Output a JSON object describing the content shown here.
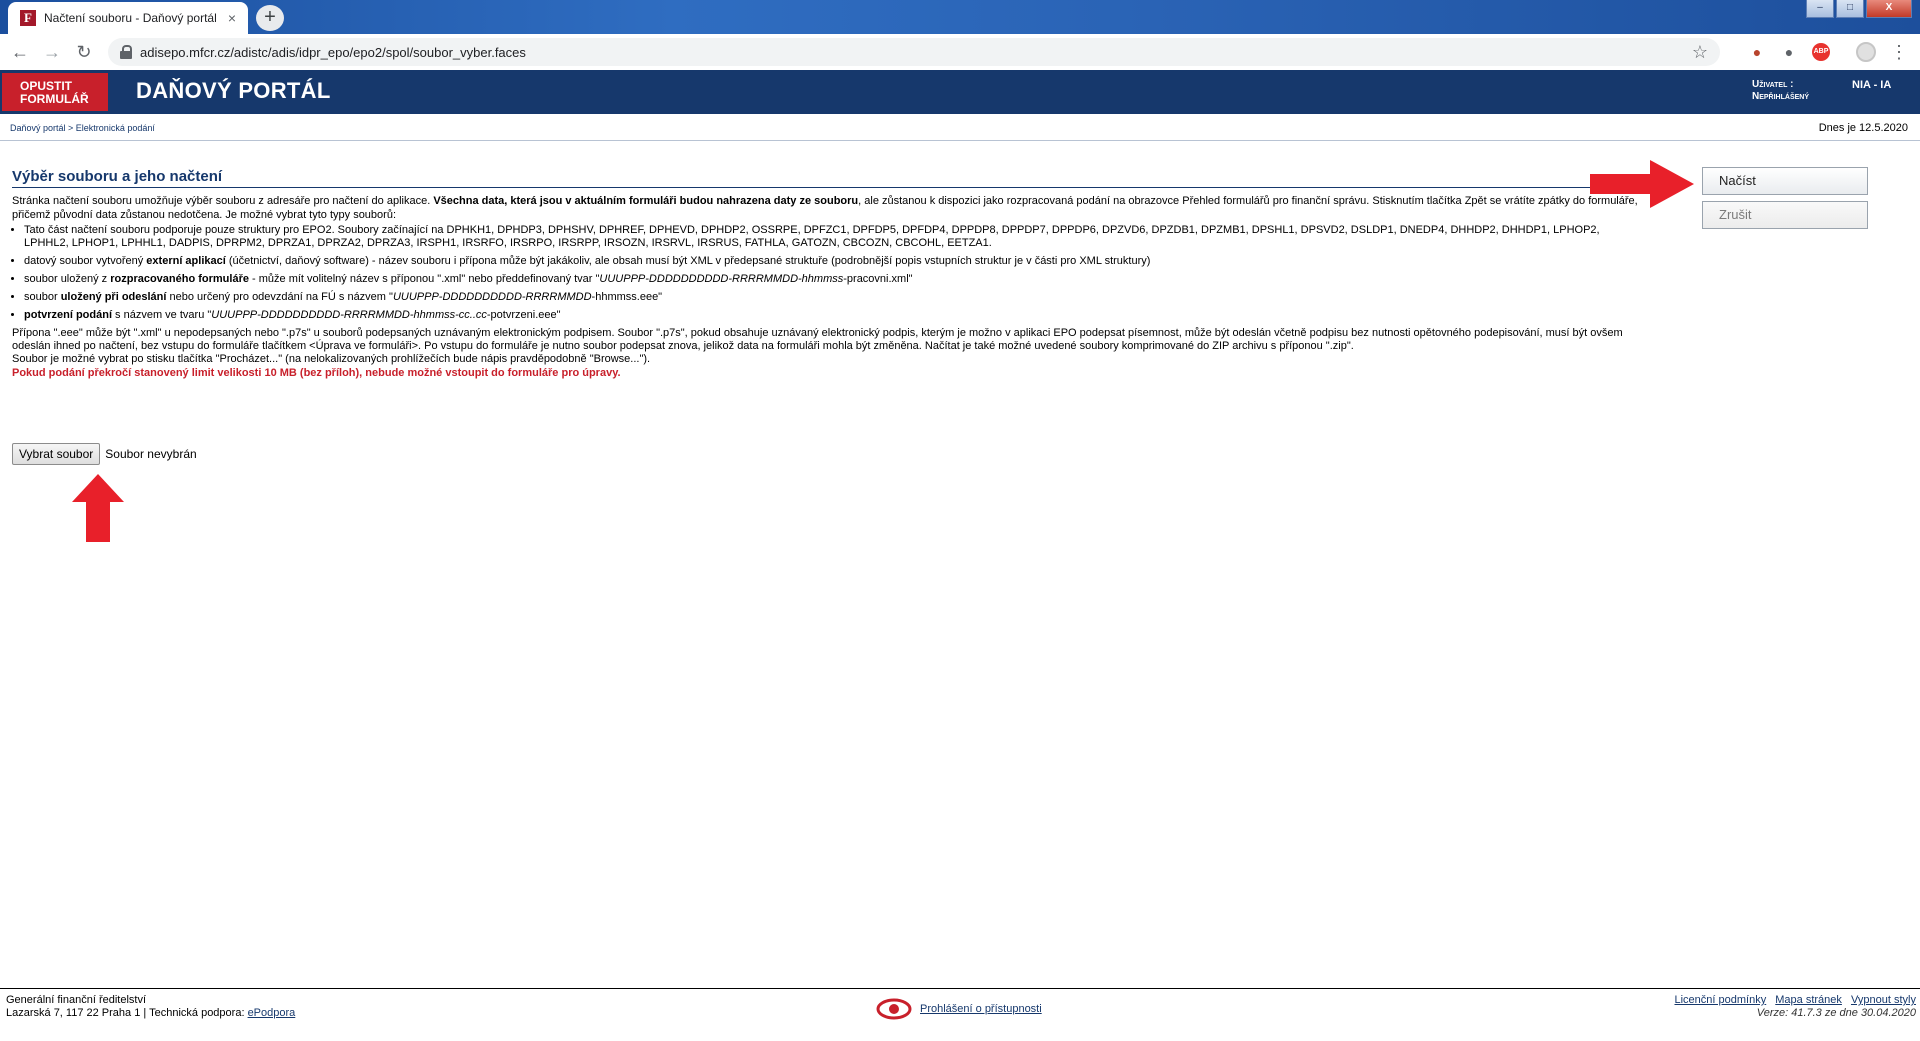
{
  "browser": {
    "tab_title": "Načtení souboru - Daňový portál",
    "tab_favicon": "F",
    "tab_close": "×",
    "new_tab": "+",
    "url": "adisepo.mfcr.cz/adistc/adis/idpr_epo/epo2/spol/soubor_vyber.faces",
    "nav": {
      "back": "←",
      "forward": "→",
      "reload": "↻",
      "star": "☆",
      "menu": "⋮"
    },
    "window_controls": {
      "minimize": "–",
      "maximize": "□",
      "close": "X"
    },
    "extensions": [
      {
        "name": "ladybug-icon",
        "glyph": "●",
        "color": "#b8442d"
      },
      {
        "name": "location-pin-icon",
        "glyph": "●",
        "color": "#5f6368"
      },
      {
        "name": "adblock-icon",
        "glyph": "ABP",
        "color": "#e8332e"
      }
    ]
  },
  "header": {
    "exit_label_1": "OPUSTIT",
    "exit_label_2": "FORMULÁŘ",
    "title": "DAŇOVÝ PORTÁL",
    "user_label_1": "Uživatel :",
    "user_label_2": "Nepřihlášený",
    "user_value": "NIA - IA"
  },
  "breadcrumb": {
    "items": [
      "Daňový portál",
      "Elektronická podání"
    ],
    "separator": " > "
  },
  "date_label": "Dnes je 12.5.2020",
  "main": {
    "title": "Výběr souboru a jeho načtení",
    "intro_1": "Stránka načtení souboru umožňuje výběr souboru z adresáře pro načtení do aplikace. ",
    "intro_bold": "Všechna data, která jsou v aktuálním formuláři budou nahrazena daty ze souboru",
    "intro_2": ", ale zůstanou k dispozici jako rozpracovaná podání na obrazovce Přehled formulářů pro finanční správu. Stisknutím tlačítka Zpět se vrátíte zpátky do formuláře, přičemž původní data zůstanou nedotčena. Je možné vybrat tyto typy souborů:",
    "item_1": "Tato část načtení souboru podporuje pouze struktury pro EPO2. Soubory začínající na DPHKH1, DPHDP3, DPHSHV, DPHREF, DPHEVD, DPHDP2, OSSRPE, DPFZC1, DPFDP5, DPFDP4, DPPDP8, DPPDP7, DPPDP6, DPZVD6, DPZDB1, DPZMB1, DPSHL1, DPSVD2, DSLDP1, DNEDP4, DHHDP2, DHHDP1, LPHOP2, LPHHL2, LPHOP1, LPHHL1, DADPIS, DPRPM2, DPRZA1, DPRZA2, DPRZA3, IRSPH1, IRSRFO, IRSRPO, IRSRPP, IRSOZN, IRSRVL, IRSRUS, FATHLA, GATOZN, CBCOZN, CBCOHL, EETZA1.",
    "item_2a": "datový soubor vytvořený ",
    "item_2b": "externí aplikací",
    "item_2c": " (účetnictví, daňový software) - název souboru i přípona může být jakákoliv, ale obsah musí být XML v předepsané struktuře (podrobnější popis vstupních struktur je v části pro XML struktury)",
    "item_3a": "soubor uložený z ",
    "item_3b": "rozpracovaného formuláře",
    "item_3c": " - může mít volitelný název s příponou \".xml\" nebo předdefinovaný tvar \"",
    "item_3d": "UUUPPP-DDDDDDDDDD-RRRRMMDD-hhmmss",
    "item_3e": "-pracovni.xml\"",
    "item_4a": "soubor ",
    "item_4b": "uložený při odeslání",
    "item_4c": " nebo určený pro odevzdání na FÚ s názvem \"",
    "item_4d": "UUUPPP-DDDDDDDDDD-RRRRMMDD",
    "item_4e": "-hhmmss.eee\"",
    "item_5a": "potvrzení podání",
    "item_5b": " s názvem ve tvaru \"",
    "item_5c": "UUUPPP-DDDDDDDDDD-RRRRMMDD-hhmmss-cc..cc",
    "item_5d": "-potvrzeni.eee\"",
    "note_1": "Přípona \".eee\" může být \".xml\" u nepodepsaných nebo \".p7s\" u souborů podepsaných uznávaným elektronickým podpisem. Soubor \".p7s\", pokud obsahuje uznávaný elektronický podpis, kterým je možno v aplikaci EPO podepsat písemnost, může být odeslán včetně podpisu bez nutnosti opětovného podepisování, musí být ovšem odeslán ihned po načtení, bez vstupu do formuláře tlačítkem <Úprava ve formuláři>. Po vstupu do formuláře je nutno soubor podepsat znova, jelikož data na formuláři mohla být změněna. Načítat je také možné uvedené soubory komprimované do ZIP archivu s příponou \".zip\".",
    "note_2": "Soubor je možné vybrat po stisku tlačítka \"Procházet...\" (na nelokalizovaných prohlížečích bude nápis pravděpodobně \"Browse...\").",
    "warning": "Pokud podání překročí stanovený limit velikosti 10 MB (bez příloh), nebude možné vstoupit do formuláře pro úpravy."
  },
  "file_input": {
    "button_label": "Vybrat soubor",
    "status": "Soubor nevybrán"
  },
  "actions": {
    "load_label": "Načíst",
    "cancel_label": "Zrušit"
  },
  "annotation_color": "#e8202a",
  "footer": {
    "org": "Generální finanční ředitelství",
    "address": "Lazarská 7, 117 22 Praha 1 | Technická podpora: ",
    "support_link": "ePodpora",
    "accessibility": "Prohlášení o přístupnosti",
    "links": [
      "Licenční podmínky",
      "Mapa stránek",
      "Vypnout styly"
    ],
    "version": "Verze: 41.7.3 ze dne 30.04.2020"
  },
  "colors": {
    "brand_navy": "#16386c",
    "brand_red": "#c8202b"
  }
}
